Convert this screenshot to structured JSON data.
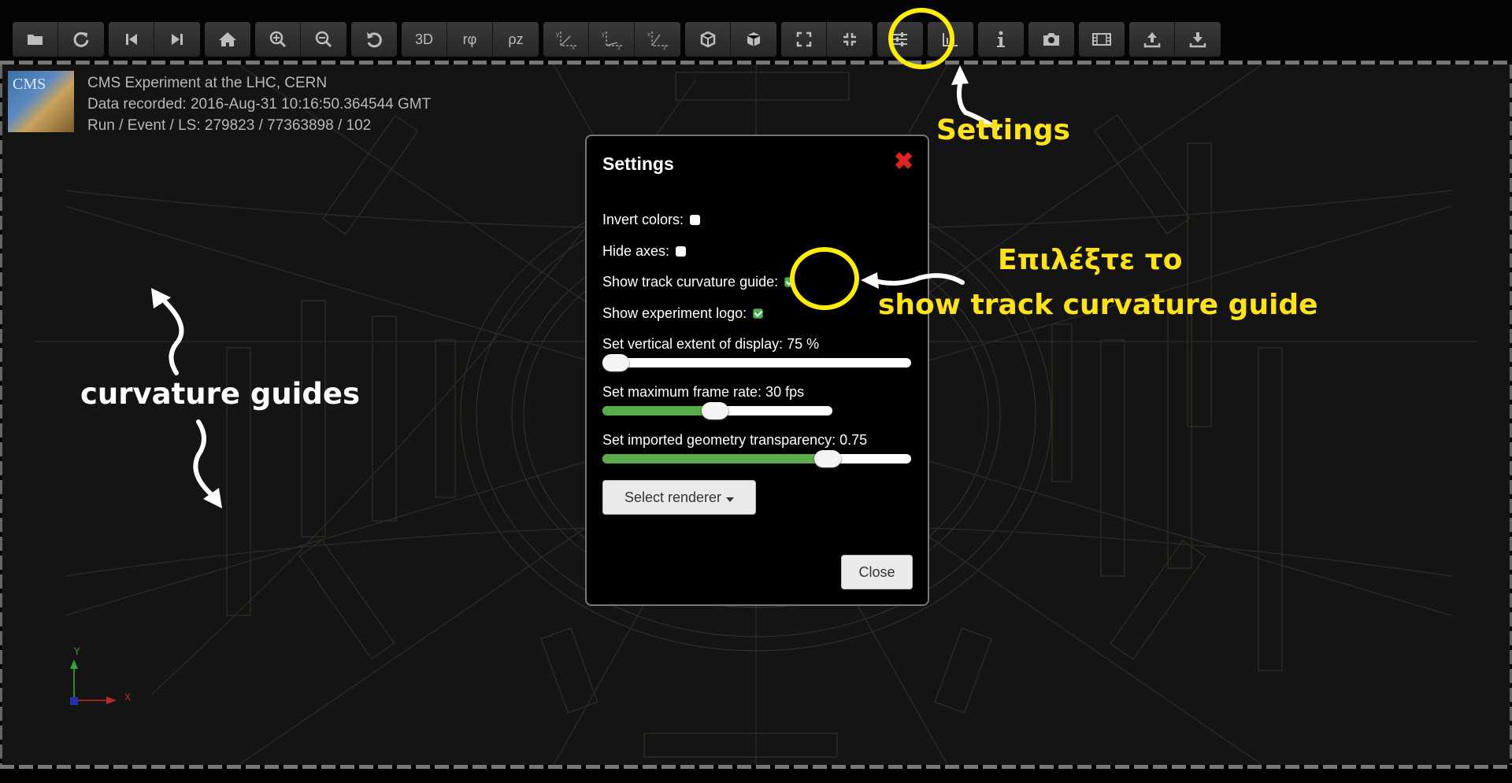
{
  "toolbar": {
    "groups": [
      [
        {
          "icon": "folder-open-icon"
        },
        {
          "icon": "reload-icon"
        }
      ],
      [
        {
          "icon": "step-backward-icon"
        },
        {
          "icon": "step-forward-icon"
        }
      ],
      [
        {
          "icon": "home-icon"
        }
      ],
      [
        {
          "icon": "zoom-in-icon"
        },
        {
          "icon": "zoom-out-icon"
        }
      ],
      [
        {
          "icon": "undo-icon"
        }
      ],
      [
        {
          "label": "3D"
        },
        {
          "label": "rφ"
        },
        {
          "label": "ρz"
        }
      ],
      [
        {
          "icon": "view-yx-icon"
        },
        {
          "icon": "view-yz-icon"
        },
        {
          "icon": "view-xz-icon"
        }
      ],
      [
        {
          "icon": "cube-outline-icon"
        },
        {
          "icon": "cube-solid-icon"
        }
      ],
      [
        {
          "icon": "fullscreen-icon"
        },
        {
          "icon": "exit-fullscreen-icon"
        }
      ],
      [
        {
          "icon": "settings-sliders-icon"
        }
      ],
      [
        {
          "icon": "bar-chart-icon"
        }
      ],
      [
        {
          "icon": "info-icon"
        }
      ],
      [
        {
          "icon": "camera-icon"
        }
      ],
      [
        {
          "icon": "film-icon"
        }
      ],
      [
        {
          "icon": "upload-icon"
        },
        {
          "icon": "download-icon"
        }
      ]
    ]
  },
  "event_info": {
    "logo_text": "CMS",
    "line1": "CMS Experiment at the LHC, CERN",
    "line2": "Data recorded: 2016-Aug-31 10:16:50.364544 GMT",
    "line3": "Run / Event / LS: 279823 / 77363898 / 102"
  },
  "settings_dialog": {
    "title": "Settings",
    "close_x": "✖",
    "invert_colors": {
      "label": "Invert colors:",
      "checked": false
    },
    "hide_axes": {
      "label": "Hide axes:",
      "checked": false
    },
    "show_track_curvature": {
      "label": "Show track curvature guide:",
      "checked": true
    },
    "show_logo": {
      "label": "Show experiment logo:",
      "checked": true
    },
    "vertical_extent": {
      "label": "Set vertical extent of display: 75 %",
      "fraction": 0.04
    },
    "frame_rate": {
      "label": "Set maximum frame rate: 30 fps",
      "fraction": 0.49
    },
    "transparency": {
      "label": "Set imported geometry transparency: 0.75",
      "fraction": 0.73
    },
    "renderer_button": "Select renderer",
    "close_button": "Close"
  },
  "annotations": {
    "settings": "Settings",
    "select_line1": "Επιλέξτε το",
    "select_line2": "show track curvature guide",
    "curvature_guides": "curvature guides"
  },
  "axes": {
    "y": "Y",
    "x": "X"
  },
  "colors": {
    "highlight": "#ffec0a",
    "check_on": "#4caf50",
    "slider_fill": "#5aab4a",
    "close_x": "#e02323"
  }
}
